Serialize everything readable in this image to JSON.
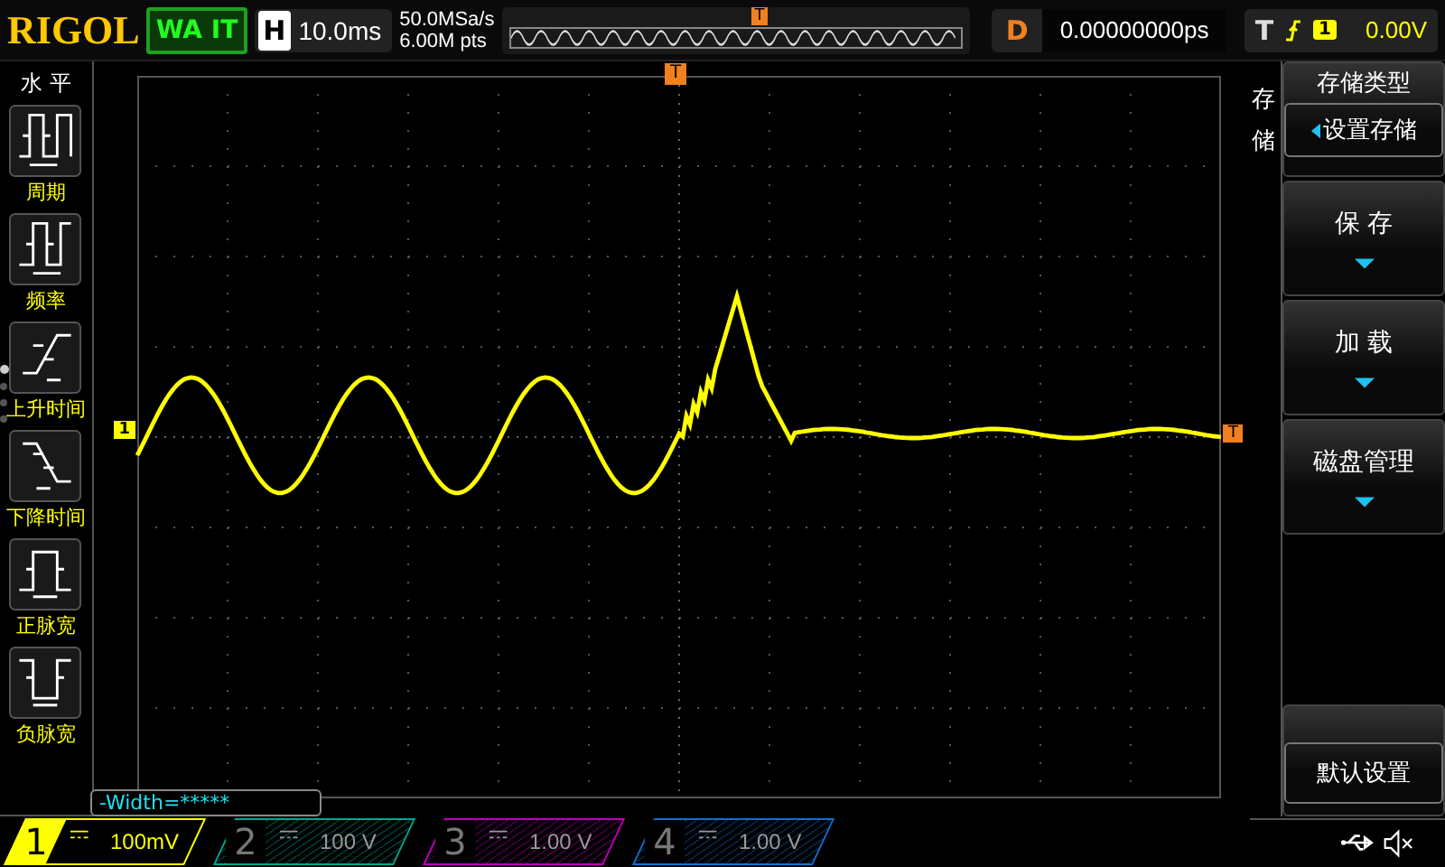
{
  "top_bar": {
    "logo": "RIGOL",
    "run_status": "WA IT",
    "horizontal": {
      "label": "H",
      "timebase": "10.0ms"
    },
    "sample_rate": "50.0MSa/s",
    "memory_depth": "6.00M pts",
    "overview_marker": "T",
    "delay": {
      "label": "D",
      "value": "0.00000000ps"
    },
    "trigger": {
      "label": "T",
      "source": "1",
      "level": "0.00V"
    }
  },
  "left_menu": {
    "title": "水 平",
    "items": [
      {
        "kind": "period",
        "label": "周期"
      },
      {
        "kind": "frequency",
        "label": "频率"
      },
      {
        "kind": "rise",
        "label": "上升时间"
      },
      {
        "kind": "fall",
        "label": "下降时间"
      },
      {
        "kind": "pos_width",
        "label": "正脉宽"
      },
      {
        "kind": "neg_width",
        "label": "负脉宽"
      }
    ],
    "pages": [
      {
        "selected": true
      },
      {
        "selected": false
      },
      {
        "selected": false
      },
      {
        "selected": false
      }
    ]
  },
  "screen": {
    "trigger_position_marker": "T",
    "channel_marker": "1",
    "trigger_level_marker": "T",
    "measurement": "-Width=*****"
  },
  "right_menu": {
    "tab": "存储",
    "items": [
      {
        "kind": "option",
        "title": "存储类型",
        "value": "设置存储"
      },
      {
        "kind": "submenu",
        "label": "保 存"
      },
      {
        "kind": "submenu",
        "label": "加 载"
      },
      {
        "kind": "submenu",
        "label": "磁盘管理"
      },
      {
        "kind": "spacer"
      },
      {
        "kind": "action",
        "label": "默认设置"
      }
    ]
  },
  "channels": [
    {
      "number": "1",
      "scale": "100mV",
      "selected": true,
      "color": "#ffff00"
    },
    {
      "number": "2",
      "scale": "100 V",
      "selected": false,
      "color": "#00a890"
    },
    {
      "number": "3",
      "scale": "1.00 V",
      "selected": false,
      "color": "#c000c0"
    },
    {
      "number": "4",
      "scale": "1.00 V",
      "selected": false,
      "color": "#1070d0"
    }
  ]
}
